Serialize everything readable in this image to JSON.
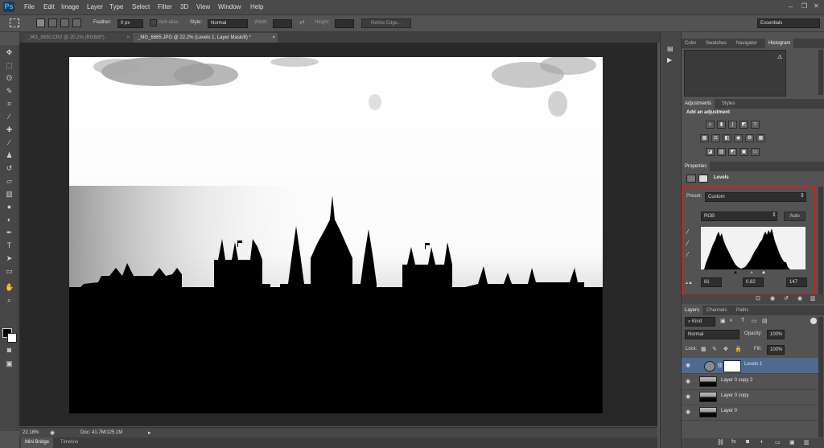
{
  "app": {
    "logo": "Ps"
  },
  "menu": [
    "File",
    "Edit",
    "Image",
    "Layer",
    "Type",
    "Select",
    "Filter",
    "3D",
    "View",
    "Window",
    "Help"
  ],
  "options_bar": {
    "feather_label": "Feather:",
    "feather_value": "0 px",
    "antialias_label": "Anti-alias",
    "style_label": "Style:",
    "style_value": "Normal",
    "width_label": "Width:",
    "height_label": "Height:",
    "refine_edge": "Refine Edge...",
    "workspace": "Essentials"
  },
  "doc_tabs": [
    {
      "label": "_MG_9830.CR2 @ 20.2% (RGB/8*)",
      "active": false
    },
    {
      "label": "_MG_6865.JPG @ 22.2% (Levels 1, Layer Mask/8) *",
      "active": true
    }
  ],
  "status": {
    "zoom": "22.18%",
    "doc": "Doc: 41.7M/125.1M"
  },
  "bottom_tabs": [
    "Mini Bridge",
    "Timeline"
  ],
  "panel_tabs_top": [
    "Color",
    "Swatches",
    "Navigator",
    "Histogram"
  ],
  "adjustments": {
    "tabs": [
      "Adjustments",
      "Styles"
    ],
    "heading": "Add an adjustment"
  },
  "properties": {
    "tab": "Properties",
    "title": "Levels",
    "preset_label": "Preset:",
    "preset_value": "Custom",
    "channel": "RGB",
    "auto": "Auto",
    "input_black": "81",
    "input_gamma": "0.82",
    "input_white": "147"
  },
  "layers": {
    "tabs": [
      "Layers",
      "Channels",
      "Paths"
    ],
    "kind": "Kind",
    "blend_mode": "Normal",
    "opacity_label": "Opacity:",
    "opacity_value": "100%",
    "lock_label": "Lock:",
    "fill_label": "Fill:",
    "fill_value": "100%",
    "items": [
      {
        "name": "Levels 1",
        "selected": true
      },
      {
        "name": "Layer 0 copy 2",
        "selected": false
      },
      {
        "name": "Layer 0 copy",
        "selected": false
      },
      {
        "name": "Layer 0",
        "selected": false
      }
    ]
  },
  "colors": {
    "highlight_box": "#d21f1f",
    "selected_layer": "#4d6a8f",
    "accent": "#41b6ff"
  }
}
